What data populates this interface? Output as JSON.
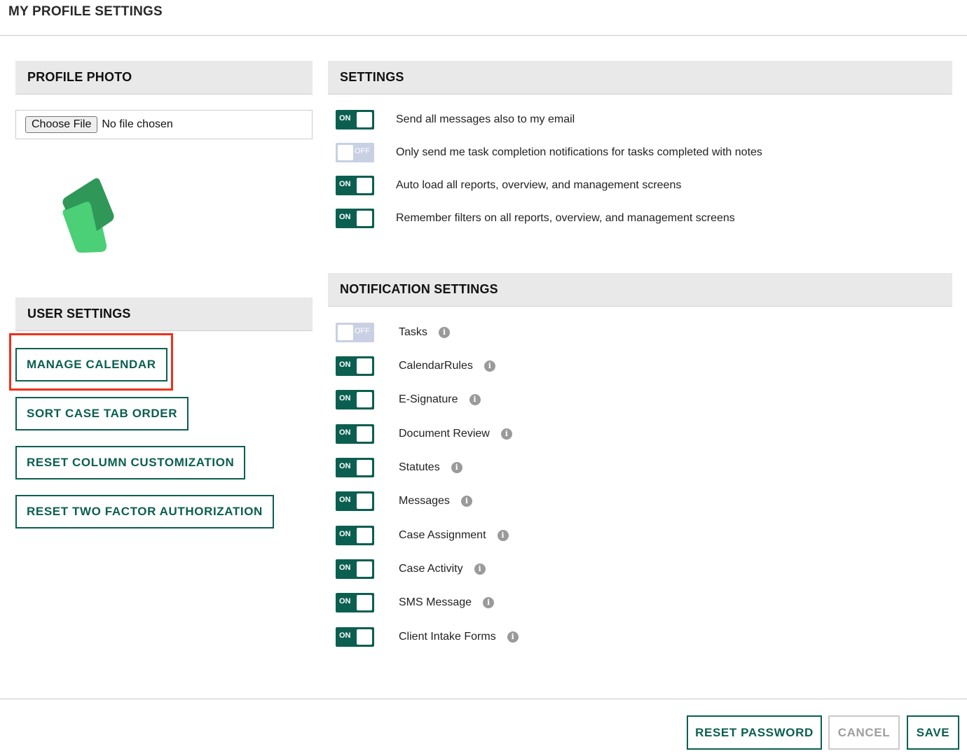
{
  "page": {
    "title": "MY PROFILE SETTINGS"
  },
  "profile_photo": {
    "heading": "PROFILE PHOTO",
    "choose_file_label": "Choose File",
    "file_status": "No file chosen"
  },
  "user_settings": {
    "heading": "USER SETTINGS",
    "buttons": [
      {
        "label": "MANAGE CALENDAR",
        "highlighted": true
      },
      {
        "label": "SORT CASE TAB ORDER"
      },
      {
        "label": "RESET COLUMN CUSTOMIZATION"
      },
      {
        "label": "RESET TWO FACTOR AUTHORIZATION"
      }
    ]
  },
  "settings": {
    "heading": "SETTINGS",
    "items": [
      {
        "state": "ON",
        "label": "Send all messages also to my email"
      },
      {
        "state": "OFF",
        "label": "Only send me task completion notifications for tasks completed with notes"
      },
      {
        "state": "ON",
        "label": "Auto load all reports, overview, and management screens"
      },
      {
        "state": "ON",
        "label": "Remember filters on all reports, overview, and management screens"
      }
    ]
  },
  "notification_settings": {
    "heading": "NOTIFICATION SETTINGS",
    "info_glyph": "i",
    "items": [
      {
        "state": "OFF",
        "label": "Tasks"
      },
      {
        "state": "ON",
        "label": "CalendarRules"
      },
      {
        "state": "ON",
        "label": "E-Signature"
      },
      {
        "state": "ON",
        "label": "Document Review"
      },
      {
        "state": "ON",
        "label": "Statutes"
      },
      {
        "state": "ON",
        "label": "Messages"
      },
      {
        "state": "ON",
        "label": "Case Assignment"
      },
      {
        "state": "ON",
        "label": "Case Activity"
      },
      {
        "state": "ON",
        "label": "SMS Message"
      },
      {
        "state": "ON",
        "label": "Client Intake Forms"
      }
    ]
  },
  "footer": {
    "reset_password": "RESET PASSWORD",
    "cancel": "CANCEL",
    "save": "SAVE"
  },
  "colors": {
    "accent": "#0b5f50",
    "toggle_off": "#c9d0e3",
    "highlight": "#f0311b"
  }
}
